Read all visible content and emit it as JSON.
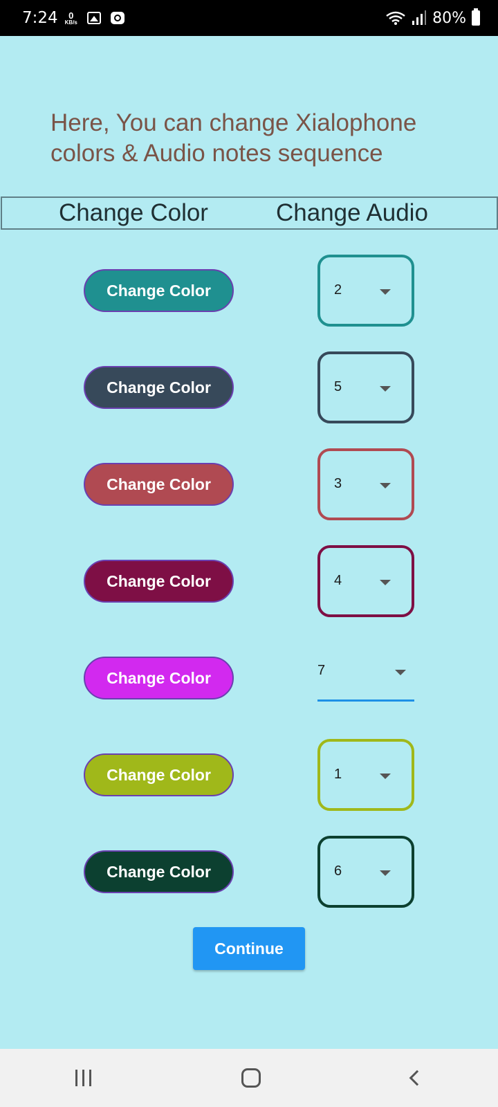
{
  "status_bar": {
    "time": "7:24",
    "speed_value": "0",
    "speed_unit": "KB/s",
    "battery": "80%",
    "icons": [
      "image-icon",
      "clock-icon",
      "wifi-icon",
      "signal-icon",
      "battery-icon"
    ]
  },
  "heading": "Here, You can change Xialophone colors & Audio notes sequence",
  "table_header": {
    "color_label": "Change Color",
    "audio_label": "Change Audio"
  },
  "rows": [
    {
      "button_label": "Change Color",
      "color": "#1f9090",
      "audio_value": "2"
    },
    {
      "button_label": "Change Color",
      "color": "#37495a",
      "audio_value": "5"
    },
    {
      "button_label": "Change Color",
      "color": "#b04a52",
      "audio_value": "3"
    },
    {
      "button_label": "Change Color",
      "color": "#7e0f45",
      "audio_value": "4"
    },
    {
      "button_label": "Change Color",
      "color": "#d229ef",
      "audio_value": "7"
    },
    {
      "button_label": "Change Color",
      "color": "#a0b81a",
      "audio_value": "1"
    },
    {
      "button_label": "Change Color",
      "color": "#0c4030",
      "audio_value": "6"
    }
  ],
  "continue_label": "Continue",
  "nav": [
    "recents-icon",
    "home-icon",
    "back-icon"
  ]
}
